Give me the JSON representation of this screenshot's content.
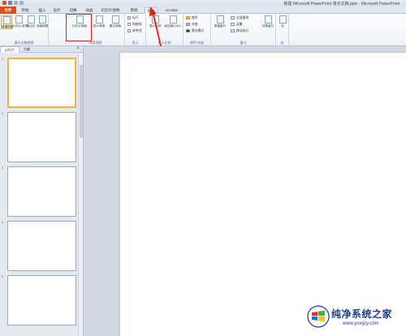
{
  "window": {
    "title": "新建 Microsoft PowerPoint 演示文稿.pptx - Microsoft PowerPoint"
  },
  "ribbon_tabs": [
    "文件",
    "开始",
    "插入",
    "设计",
    "切换",
    "动画",
    "幻灯片放映",
    "审阅",
    "视图",
    "Acrobat"
  ],
  "active_tab": "视图",
  "groups": {
    "presentation_views": {
      "label": "演示文稿视图",
      "buttons": [
        "普通视图",
        "幻灯片浏览",
        "备注页",
        "阅读视图"
      ]
    },
    "master_views": {
      "label": "母版视图",
      "buttons": [
        "幻灯片母版",
        "讲义母版",
        "备注母版"
      ]
    },
    "show": {
      "label": "显示",
      "items": [
        "标尺",
        "网格线",
        "参考线"
      ]
    },
    "zoom": {
      "label": "显示比例",
      "buttons": [
        "显示比例",
        "适应窗口大小"
      ]
    },
    "color": {
      "label": "颜色/灰度",
      "items": [
        "颜色",
        "灰度",
        "黑白模式"
      ]
    },
    "window": {
      "label": "窗口",
      "buttons": [
        "新建窗口"
      ],
      "items": [
        "全部重排",
        "层叠",
        "移动拆分"
      ],
      "switch": "切换窗口"
    },
    "macro": {
      "label": "宏",
      "buttons": [
        "宏"
      ]
    }
  },
  "pane": {
    "tabs": [
      "幻灯片",
      "大纲"
    ],
    "close": "×",
    "slide_numbers": [
      "1",
      "2",
      "3",
      "4",
      "5"
    ]
  },
  "watermark": {
    "text": "纯净系统之家",
    "url": "www.ycwjzy.com"
  },
  "colors": {
    "file_tab": "#d9501e",
    "highlight": "#e0211a",
    "selection": "#f0b43a"
  }
}
